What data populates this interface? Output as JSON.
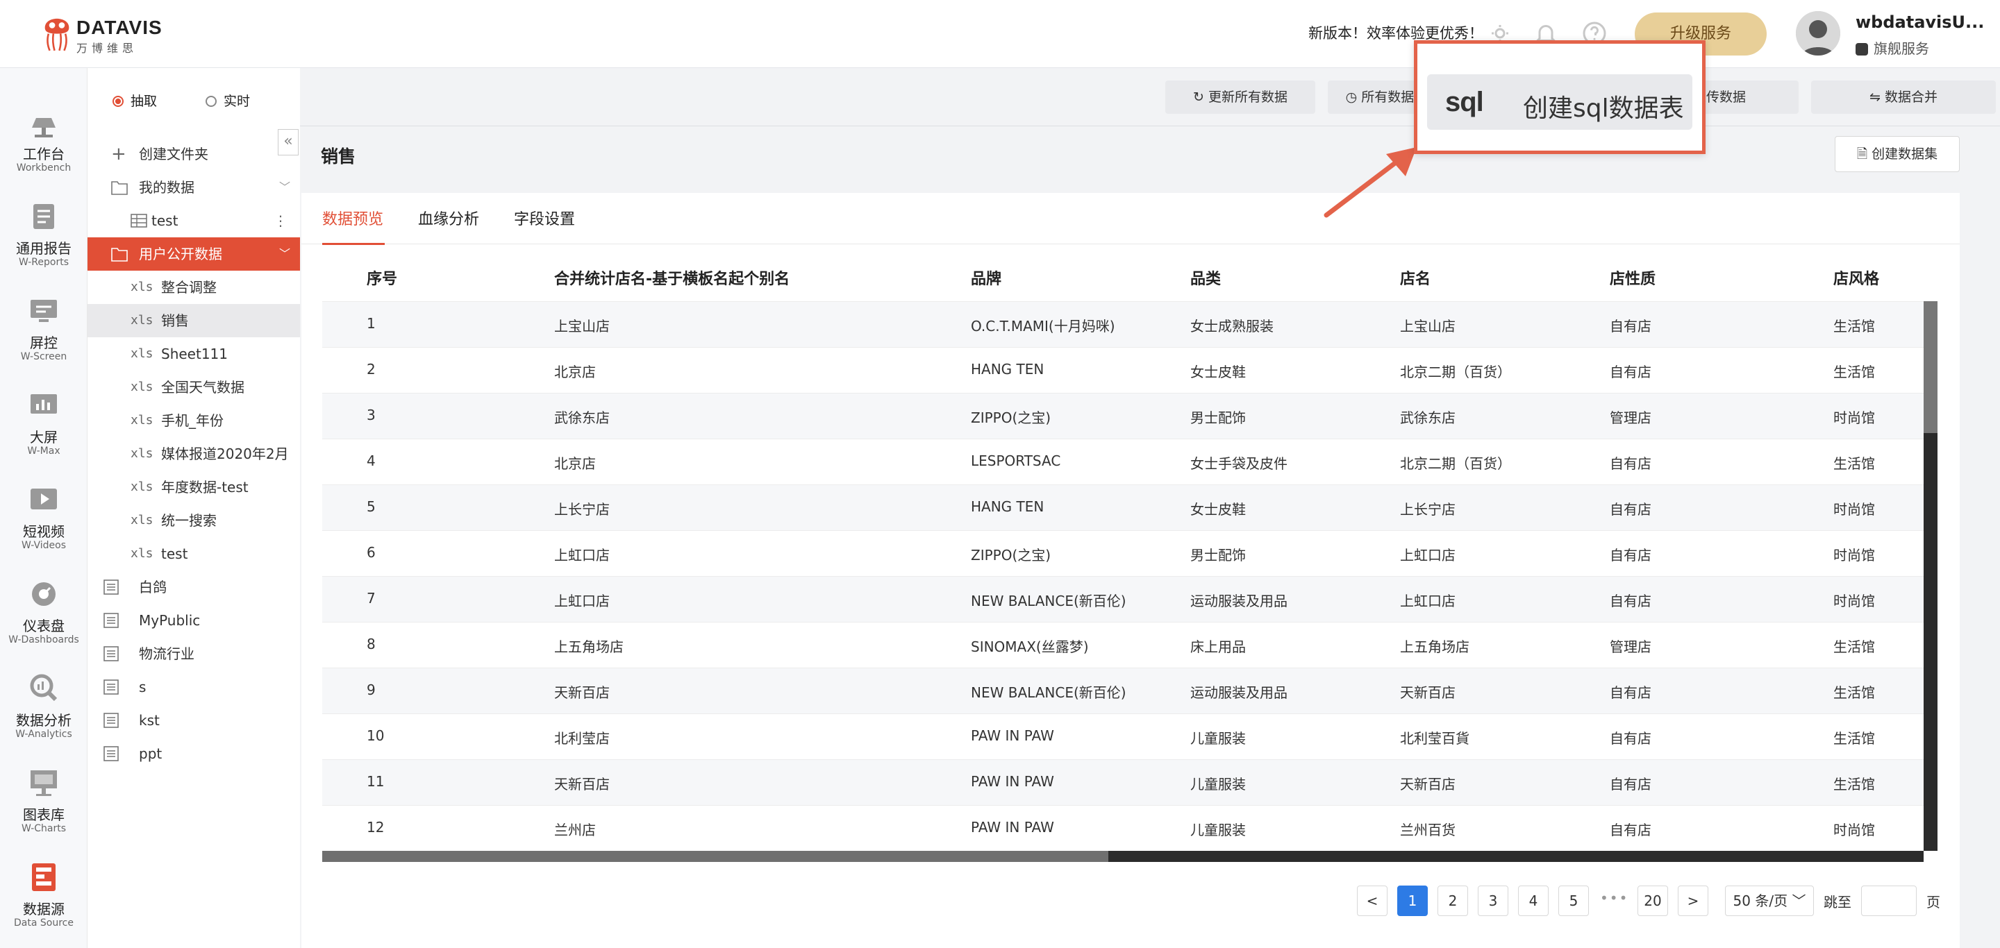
{
  "brand": {
    "name": "DATAVIS",
    "subtitle": "万博维思"
  },
  "header": {
    "notice": "新版本！效率体验更优秀！",
    "upgrade": "升级服务",
    "username": "wbdatavisU...",
    "plan": "旗舰服务"
  },
  "nav": [
    {
      "label": "工作台",
      "en": "Workbench",
      "icon": "lamp-icon"
    },
    {
      "label": "通用报告",
      "en": "W-Reports",
      "icon": "report-icon"
    },
    {
      "label": "屏控",
      "en": "W-Screen",
      "icon": "screen-control-icon"
    },
    {
      "label": "大屏",
      "en": "W-Max",
      "icon": "big-screen-icon"
    },
    {
      "label": "短视频",
      "en": "W-Videos",
      "icon": "video-icon"
    },
    {
      "label": "仪表盘",
      "en": "W-Dashboards",
      "icon": "gauge-icon"
    },
    {
      "label": "数据分析",
      "en": "W-Analytics",
      "icon": "analytics-icon"
    },
    {
      "label": "图表库",
      "en": "W-Charts",
      "icon": "charts-icon"
    },
    {
      "label": "数据源",
      "en": "Data Source",
      "icon": "datasource-icon"
    }
  ],
  "mode": {
    "extract": "抽取",
    "realtime": "实时"
  },
  "sidebar": {
    "create_folder": "创建文件夹",
    "my_data": "我的数据",
    "test": "test",
    "public_data": "用户公开数据",
    "xls_prefix": "xls",
    "files": [
      "整合调整",
      "销售",
      "Sheet111",
      "全国天气数据",
      "手机_年份",
      "媒体报道2020年2月",
      "年度数据-test",
      "统一搜索",
      "test"
    ],
    "groups": [
      "白鸽",
      "MyPublic",
      "物流行业",
      "s",
      "kst",
      "ppt"
    ]
  },
  "toolbar": {
    "refresh_all": "更新所有数据",
    "all_data": "所有数据",
    "upload": "上传数据",
    "merge": "数据合并"
  },
  "page": {
    "title": "销售",
    "create_dataset": "创建数据集"
  },
  "tabs": [
    "数据预览",
    "血缘分析",
    "字段设置"
  ],
  "table": {
    "columns": [
      "序号",
      "合并统计店名-基于横板名起个别名",
      "品牌",
      "品类",
      "店名",
      "店性质",
      "店风格"
    ],
    "rows": [
      [
        "1",
        "上宝山店",
        "O.C.T.MAMI(十月妈咪)",
        "女士成熟服装",
        "上宝山店",
        "自有店",
        "生活馆"
      ],
      [
        "2",
        "北京店",
        "HANG TEN",
        "女士皮鞋",
        "北京二期（百货）",
        "自有店",
        "生活馆"
      ],
      [
        "3",
        "武徐东店",
        "ZIPPO(之宝)",
        "男士配饰",
        "武徐东店",
        "管理店",
        "时尚馆"
      ],
      [
        "4",
        "北京店",
        "LESPORTSAC",
        "女士手袋及皮件",
        "北京二期（百货）",
        "自有店",
        "生活馆"
      ],
      [
        "5",
        "上长宁店",
        "HANG TEN",
        "女士皮鞋",
        "上长宁店",
        "自有店",
        "时尚馆"
      ],
      [
        "6",
        "上虹口店",
        "ZIPPO(之宝)",
        "男士配饰",
        "上虹口店",
        "自有店",
        "时尚馆"
      ],
      [
        "7",
        "上虹口店",
        "NEW BALANCE(新百伦)",
        "运动服装及用品",
        "上虹口店",
        "自有店",
        "时尚馆"
      ],
      [
        "8",
        "上五角场店",
        "SINOMAX(丝露梦)",
        "床上用品",
        "上五角场店",
        "管理店",
        "生活馆"
      ],
      [
        "9",
        "天新百店",
        "NEW BALANCE(新百伦)",
        "运动服装及用品",
        "天新百店",
        "自有店",
        "生活馆"
      ],
      [
        "10",
        "北利莹店",
        "PAW IN PAW",
        "儿童服装",
        "北利莹百貨",
        "自有店",
        "生活馆"
      ],
      [
        "11",
        "天新百店",
        "PAW IN PAW",
        "儿童服装",
        "天新百店",
        "自有店",
        "生活馆"
      ],
      [
        "12",
        "兰州店",
        "PAW IN PAW",
        "儿童服装",
        "兰州百货",
        "自有店",
        "时尚馆"
      ]
    ]
  },
  "pagination": {
    "prev": "<",
    "next": ">",
    "pages": [
      "1",
      "2",
      "3",
      "4",
      "5"
    ],
    "ellipsis": "•••",
    "last": "20",
    "current": 1,
    "page_size": "50 条/页",
    "jump_label": "跳至",
    "page_suffix": "页"
  },
  "callout": {
    "sql_label": "sql",
    "text": "创建sql数据表"
  },
  "colors": {
    "accent": "#e14f36",
    "primary_blue": "#2d7be5",
    "upgrade_gold": "#e8cf98",
    "callout_border": "#e3634a"
  }
}
